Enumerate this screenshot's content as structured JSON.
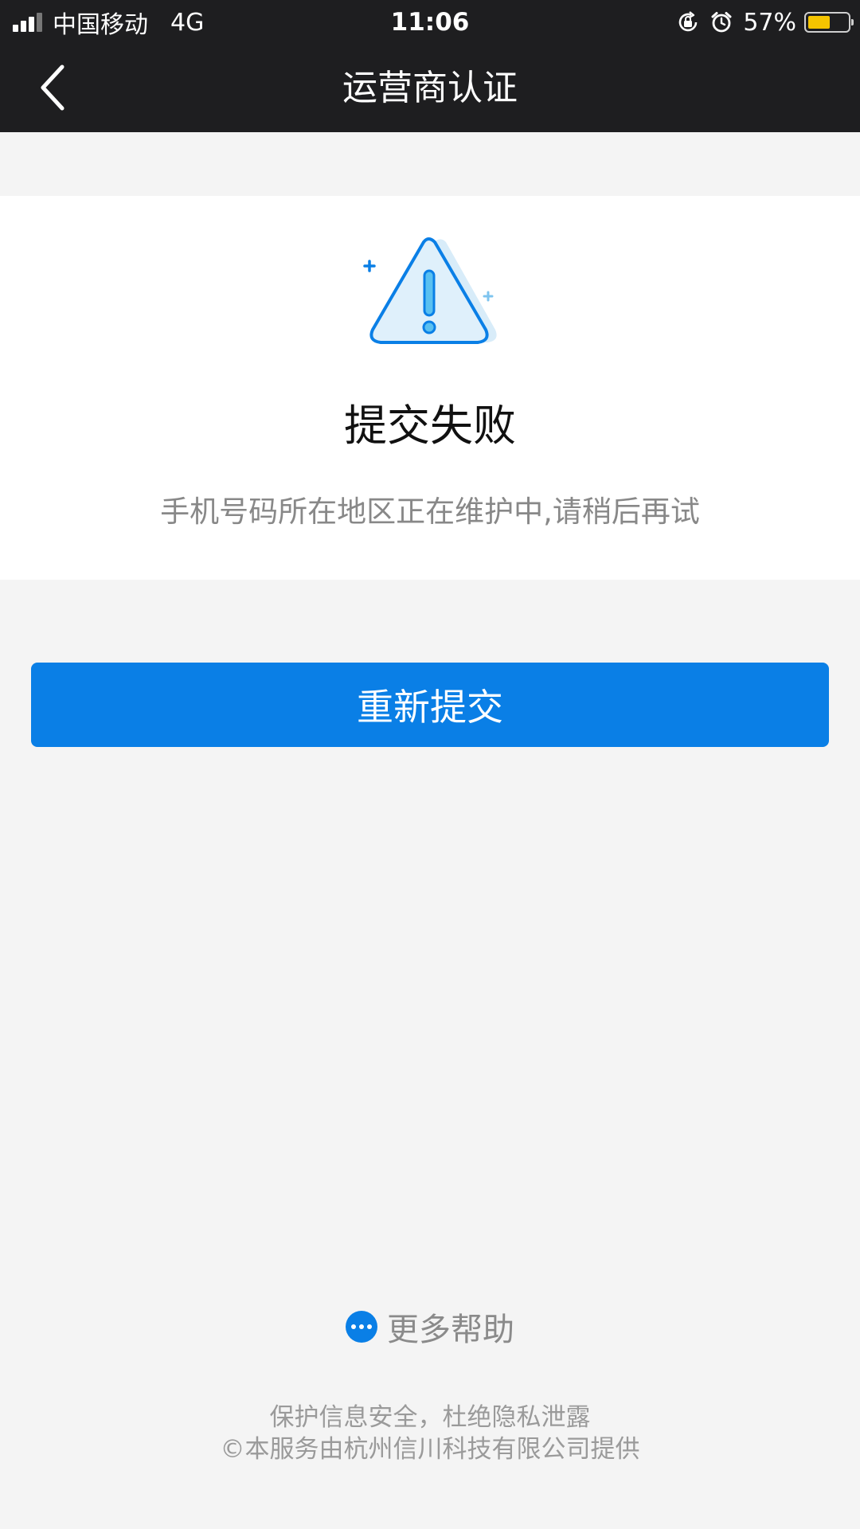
{
  "status_bar": {
    "carrier": "中国移动",
    "network": "4G",
    "time": "11:06",
    "battery_percent_label": "57%",
    "battery_level": 0.57
  },
  "nav": {
    "title": "运营商认证",
    "back_icon": "chevron-left-icon"
  },
  "result": {
    "icon": "warning-triangle-icon",
    "title": "提交失败",
    "message": "手机号码所在地区正在维护中,请稍后再试"
  },
  "actions": {
    "resubmit_label": "重新提交"
  },
  "help": {
    "icon": "more-dots-icon",
    "label": "更多帮助"
  },
  "footer": {
    "line1": "保护信息安全，杜绝隐私泄露",
    "line2": "©本服务由杭州信川科技有限公司提供"
  },
  "colors": {
    "accent": "#0a7fe6",
    "header_bg": "#1e1e20",
    "page_bg": "#f4f4f4",
    "battery": "#f5c400"
  }
}
